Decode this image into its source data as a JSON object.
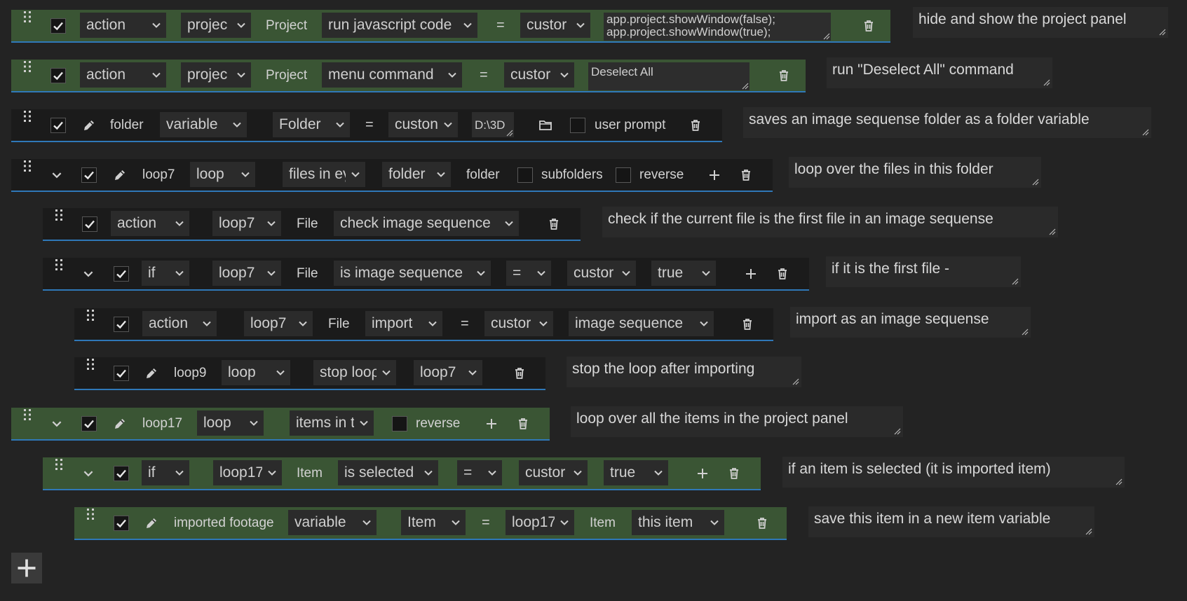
{
  "rows": [
    {
      "sel": [
        "action",
        "projec",
        "run javascript code",
        "custor"
      ],
      "lbl": [
        "Project",
        "="
      ],
      "code": [
        "app.project.showWindow(false);",
        "app.project.showWindow(true);"
      ],
      "note": "hide and show the project panel"
    },
    {
      "sel": [
        "action",
        "projec",
        "menu command",
        "custor"
      ],
      "lbl": [
        "Project",
        "="
      ],
      "code": [
        "Deselect All"
      ],
      "note": "run \"Deselect All\" command"
    },
    {
      "sel": [
        "variable",
        "Folder",
        "custon"
      ],
      "lbl": [
        "folder",
        "=",
        "user prompt"
      ],
      "path": "D:\\3D",
      "note": "saves an image sequense folder as a folder variable"
    },
    {
      "sel": [
        "loop",
        "files in eγ",
        "folder"
      ],
      "lbl": [
        "loop7",
        "folder",
        "subfolders",
        "reverse"
      ],
      "note": "loop over the files in this folder"
    },
    {
      "sel": [
        "action",
        "loop7",
        "check image sequence"
      ],
      "lbl": [
        "File"
      ],
      "note": "check if the current file is the first file in an image sequense"
    },
    {
      "sel": [
        "if",
        "loop7",
        "is image sequence",
        "=",
        "custor",
        "true"
      ],
      "lbl": [
        "File"
      ],
      "note": "if it is the first file -"
    },
    {
      "sel": [
        "action",
        "loop7",
        "import",
        "custor",
        "image sequence"
      ],
      "lbl": [
        "File",
        "="
      ],
      "note": "import as an image sequense"
    },
    {
      "sel": [
        "loop",
        "stop looρ",
        "loop7"
      ],
      "lbl": [
        "loop9"
      ],
      "note": "stop the loop after importing"
    },
    {
      "sel": [
        "loop",
        "items in t"
      ],
      "lbl": [
        "loop17",
        "reverse"
      ],
      "note": "loop over all the items in the project panel"
    },
    {
      "sel": [
        "if",
        "loop17",
        "is selected",
        "=",
        "custor",
        "true"
      ],
      "lbl": [
        "Item"
      ],
      "note": "if an item is selected (it is imported item)"
    },
    {
      "sel": [
        "variable",
        "Item",
        "loop17",
        "this item"
      ],
      "lbl": [
        "imported footage",
        "=",
        "Item"
      ],
      "note": "save this item in a new item variable"
    }
  ],
  "colors": {
    "green_row": "#3a5534",
    "dark_row": "#1b1b1b",
    "accent": "#2f78b8",
    "background": "#232323"
  }
}
